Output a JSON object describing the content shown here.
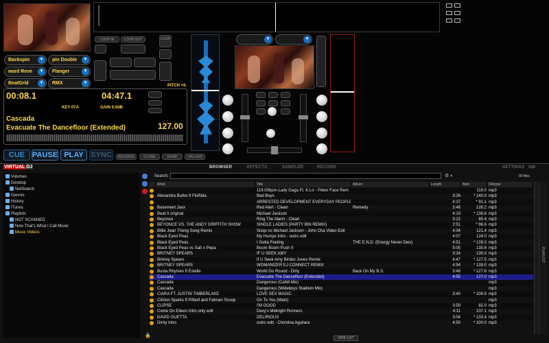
{
  "deck_left": {
    "effects": [
      "Backspin",
      "pin Double",
      "ward Reve",
      "Flanger",
      "BeatGrid",
      "RMX"
    ],
    "loop_in": "LOOP IN",
    "loop_out": "LOOP OUT",
    "loop": "LOOP",
    "time_elapsed": "00:08.1",
    "time_remaining": "04:47.1",
    "key": "KEY 07A",
    "gain": "GAIN 0.0dB",
    "artist": "Cascada",
    "title": "Evacuate The Dancefloor (Extended)",
    "bpm": "127.00",
    "pitch": "PITCH +0.",
    "buttons": {
      "cue": "CUE",
      "pause": "PAUSE",
      "play": "PLAY",
      "sync": "SYNC"
    },
    "small_buttons": [
      "REVERSE",
      "CLONE",
      "DUMP",
      "UNLOAD"
    ]
  },
  "browser": {
    "logo_a": "VIRTUAL",
    "logo_b": "DJ",
    "tabs": [
      "BROWSER",
      "EFFECTS",
      "SAMPLER",
      "RECORD"
    ],
    "settings": "SETTINGS",
    "search_label": "Search:",
    "search_value": "",
    "file_count": "90 files",
    "side_label": "PLAYLIST",
    "side_list": "SIDE LIST",
    "tree": [
      "Volumes",
      "Desktop",
      "NetSearch",
      "Genres",
      "History",
      "iTunes",
      "Playlists",
      "NOT SCANNED",
      "Now That's What I Call Music",
      "Music Videos"
    ],
    "columns": [
      "Artist",
      "Title",
      "Album",
      "Length",
      "Bpm",
      "Filetype"
    ],
    "rows": [
      [
        "",
        "119.00bpm-Lady Gaga Ft. K.Lo - Poker Face Rem",
        "",
        "",
        "119.0",
        "mp3"
      ],
      [
        "Alexandra Burke ft FloRida",
        "Bad Boys",
        "",
        "3:26",
        "* 140.0",
        "mp3"
      ],
      [
        "",
        "ARRESTED DEVELOPMENT EVERYDAY PEOPLE",
        "",
        "4:37",
        "* 91.1",
        "mp3"
      ],
      [
        "Basement Jaxx",
        "Red Alert - Clean",
        "Remedy",
        "3:48",
        "126.2",
        "mp3"
      ],
      [
        "Beat It original",
        "Michael Jackson",
        "",
        "4:19",
        "* 138.8",
        "mp3"
      ],
      [
        "Beyonce",
        "Ring The Alarm - Clean",
        "",
        "3:22",
        "85.4",
        "mp3"
      ],
      [
        "BEYONCE VS. THE ANDY GRIFFITH SHOW",
        "SINGLE LADIES (PARTY BIN REMIX)",
        "",
        "2:51",
        "* 96.6",
        "mp3"
      ],
      [
        "Billie Jean Thong Song Remix",
        "Sisqo vs Michael Jackson - John Cha Video Edit",
        "",
        "4:04",
        "121.4",
        "mp3"
      ],
      [
        "Black Eyed Peas",
        "My Humps Intro - outro edit",
        "",
        "4:07",
        "124.0",
        "mp3"
      ],
      [
        "Black Eyed Peas",
        "I Gotta Feeling",
        "THE E.N.D. (Energy Never Dies)",
        "4:51",
        "* 128.0",
        "mp3"
      ],
      [
        "Black Eyed Peas vs Salt n Pepa",
        "Boom Boom Push It",
        "",
        "5:05",
        "130.6",
        "mp3"
      ],
      [
        "BRITNEY SPEARS",
        "IF U SEEK AMY",
        "",
        "3:24",
        "130.0",
        "mp3"
      ],
      [
        "Britney Spears",
        "If U Seek Amy Bimbo Jones Remix",
        "",
        "4:47",
        "* 127.5",
        "mp3"
      ],
      [
        "BRITNEY SPEARS",
        "WOMANIZER  EJ CONNECT REMIX",
        "",
        "4:54",
        "* 139.0",
        "mp3"
      ],
      [
        "Busta Rhymes ft Estelle",
        "World Go Round - Dirty",
        "Back On My B.S.",
        "3:48",
        "* 127.6",
        "mp3"
      ],
      [
        "Cascada",
        "Evacuate The Dancefloor (Extended)",
        "",
        "4:55",
        "127.0",
        "mp3"
      ],
      [
        "Cascada",
        "Dangerous (Cahill Mix)",
        "",
        "",
        "",
        "mp3"
      ],
      [
        "Cascada",
        "Dangerous (Wideboys Stadium Mix)",
        "",
        "",
        "",
        "mp3"
      ],
      [
        "CIARA FT. JUSTIN TIMBERLAKE",
        "LOVE SEX MAGIC",
        "",
        "3:40",
        "* 106.9",
        "mp3"
      ],
      [
        "Clinton Sparks ft Pitbull and Fatman Scoop",
        "On To You (Main)",
        "",
        "",
        "",
        "mp3"
      ],
      [
        "CLIPSE",
        "I'M GOOD",
        "",
        "3:59",
        "82.0",
        "mp3"
      ],
      [
        "Come On Eileen Intro only edit",
        "Dexy's Midnight Runners",
        "",
        "4:11",
        "107.1",
        "mp3"
      ],
      [
        "DAVID GUETTA",
        "DELIRIOUS",
        "",
        "3:04",
        "* 133.4",
        "mp3"
      ],
      [
        "Dirrty Intro",
        "outro edit - Christina Aguilara",
        "",
        "4:50",
        "* 100.0",
        "mp3"
      ]
    ],
    "selected_row": 15
  },
  "colors": {
    "accent_yellow": "#ffd84a",
    "accent_blue": "#2a8ad8",
    "selected_row": "#1d1d8a"
  }
}
